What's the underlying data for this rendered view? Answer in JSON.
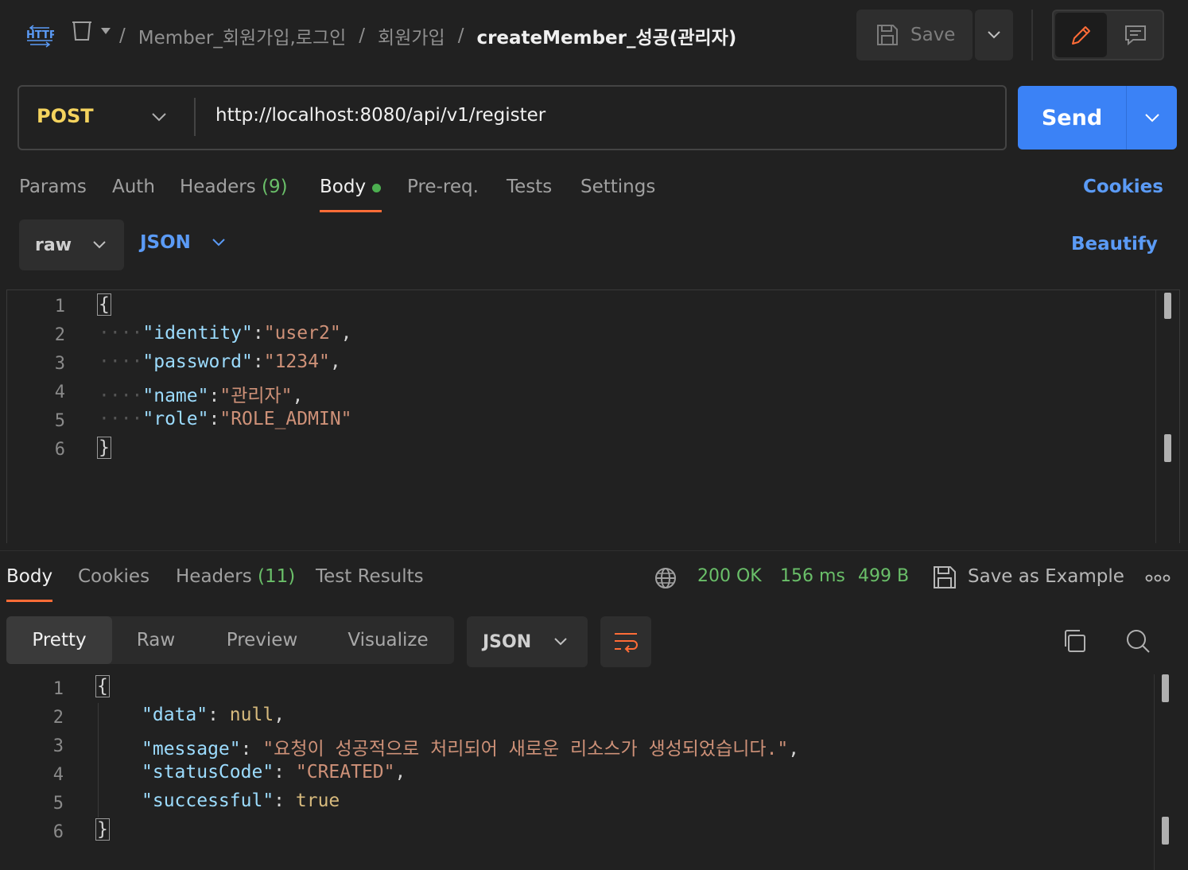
{
  "header": {
    "icons": {
      "request_type": "http-icon",
      "collection": "collection-icon",
      "edit": "pencil-icon",
      "comment": "comment-icon",
      "save": "floppy-disk-icon"
    },
    "breadcrumb": [
      "Member_회원가입,로그인",
      "회원가입"
    ],
    "current_request": "createMember_성공(관리자)",
    "separator": "/",
    "save_label": "Save",
    "accent_edit_color": "#ff6c37"
  },
  "request": {
    "method": "POST",
    "url": "http://localhost:8080/api/v1/register",
    "send_label": "Send",
    "tabs": {
      "params": "Params",
      "auth": "Auth",
      "headers": "Headers",
      "headers_count": "(9)",
      "body": "Body",
      "prereq": "Pre-req.",
      "tests": "Tests",
      "settings": "Settings"
    },
    "cookies_label": "Cookies",
    "body_mode": "raw",
    "body_language": "JSON",
    "beautify_label": "Beautify",
    "body_lines": [
      {
        "no": "1",
        "text": "{"
      },
      {
        "no": "2",
        "key": "\"identity\"",
        "value": "\"user2\"",
        "trail": ","
      },
      {
        "no": "3",
        "key": "\"password\"",
        "value": "\"1234\"",
        "trail": ","
      },
      {
        "no": "4",
        "key": "\"name\"",
        "value": "\"관리자\"",
        "trail": ","
      },
      {
        "no": "5",
        "key": "\"role\"",
        "value": "\"ROLE_ADMIN\"",
        "trail": ""
      },
      {
        "no": "6",
        "text": "}"
      }
    ]
  },
  "response": {
    "tabs": {
      "body": "Body",
      "cookies": "Cookies",
      "headers": "Headers",
      "headers_count": "(11)",
      "test_results": "Test Results"
    },
    "status": "200 OK",
    "time": "156 ms",
    "size": "499 B",
    "save_example_label": "Save as Example",
    "views": [
      "Pretty",
      "Raw",
      "Preview",
      "Visualize"
    ],
    "active_view": "Pretty",
    "format": "JSON",
    "body_lines": [
      {
        "no": "1",
        "text": "{"
      },
      {
        "no": "2",
        "key": "\"data\"",
        "value": "null",
        "value_type": "keyword",
        "trail": ","
      },
      {
        "no": "3",
        "key": "\"message\"",
        "value": "\"요청이 성공적으로 처리되어 새로운 리소스가 생성되었습니다.\"",
        "value_type": "string",
        "trail": ","
      },
      {
        "no": "4",
        "key": "\"statusCode\"",
        "value": "\"CREATED\"",
        "value_type": "string",
        "trail": ","
      },
      {
        "no": "5",
        "key": "\"successful\"",
        "value": "true",
        "value_type": "keyword",
        "trail": ""
      },
      {
        "no": "6",
        "text": "}"
      }
    ],
    "status_color": "#6abf69"
  },
  "colors": {
    "send_button": "#3b82f6",
    "method": "#f4d35e",
    "link": "#5b9bf6",
    "tab_underline": "#ff6c37"
  }
}
